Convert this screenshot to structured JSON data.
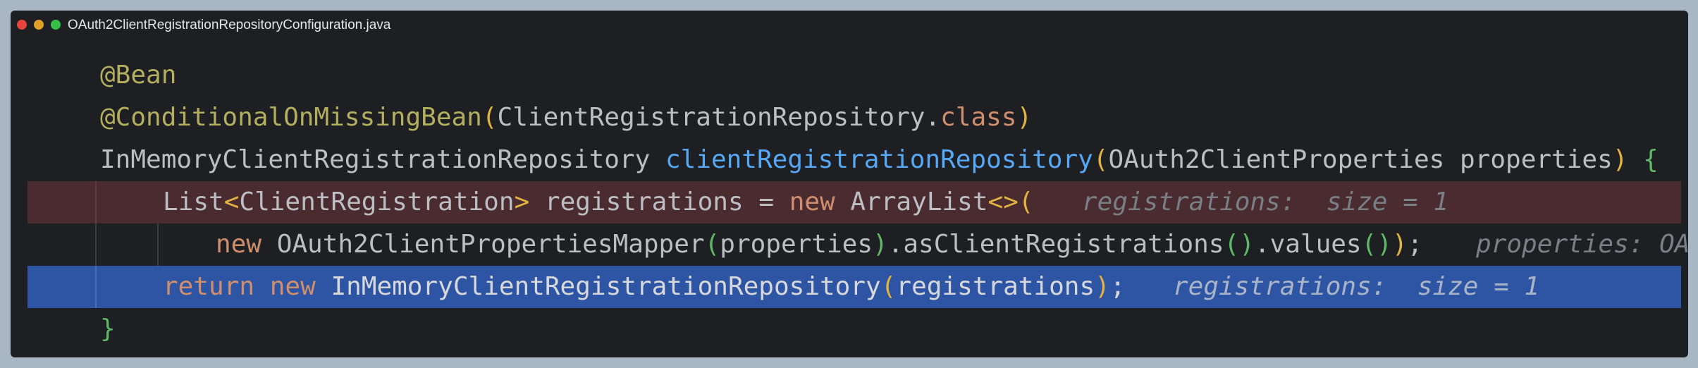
{
  "window": {
    "title": "OAuth2ClientRegistrationRepositoryConfiguration.java",
    "traffic_lights": [
      "close",
      "minimize",
      "zoom"
    ]
  },
  "colors": {
    "background": "#1e1f22",
    "annotation": "#b3ae60",
    "keyword": "#cf8e6d",
    "method_declaration": "#56a8f5",
    "paren": "#e2b340",
    "brace": "#5fb865",
    "inlay_hint": "#7a7e85",
    "error_line": "#4a2b2f",
    "selected_line": "#2e55a3"
  },
  "code": {
    "line1": {
      "ann": "@Bean"
    },
    "line2": {
      "ann": "@ConditionalOnMissingBean",
      "p_open": "(",
      "cls": "ClientRegistrationRepository.",
      "kw": "class",
      "p_close": ")"
    },
    "line3": {
      "type": "InMemoryClientRegistrationRepository ",
      "method": "clientRegistrationRepository",
      "p_open": "(",
      "params": "OAuth2ClientProperties properties",
      "p_close": ")",
      "brace": " {"
    },
    "line4": {
      "list": "List",
      "lt": "<",
      "generic": "ClientRegistration",
      "gt": ">",
      "decl": " registrations = ",
      "kw": "new",
      "arraylist": " ArrayList",
      "diamond": "<>",
      "p_open": "(",
      "hint": "registrations:  size = 1"
    },
    "line5": {
      "kw": "new",
      "mapper": " OAuth2ClientPropertiesMapper",
      "p1o": "(",
      "arg": "properties",
      "p1c": ")",
      "m1": ".asClientRegistrations",
      "p2": "()",
      "m2": ".values",
      "p3": "()",
      "p_close": ")",
      "semi": ";",
      "hint": "properties: OA"
    },
    "line6": {
      "kw_return": "return",
      "kw_new": "new",
      "cls": " InMemoryClientRegistrationRepository",
      "p_open": "(",
      "arg": "registrations",
      "p_close": ")",
      "semi": ";",
      "hint": "registrations:  size = 1"
    },
    "line7": {
      "brace": "}"
    }
  }
}
